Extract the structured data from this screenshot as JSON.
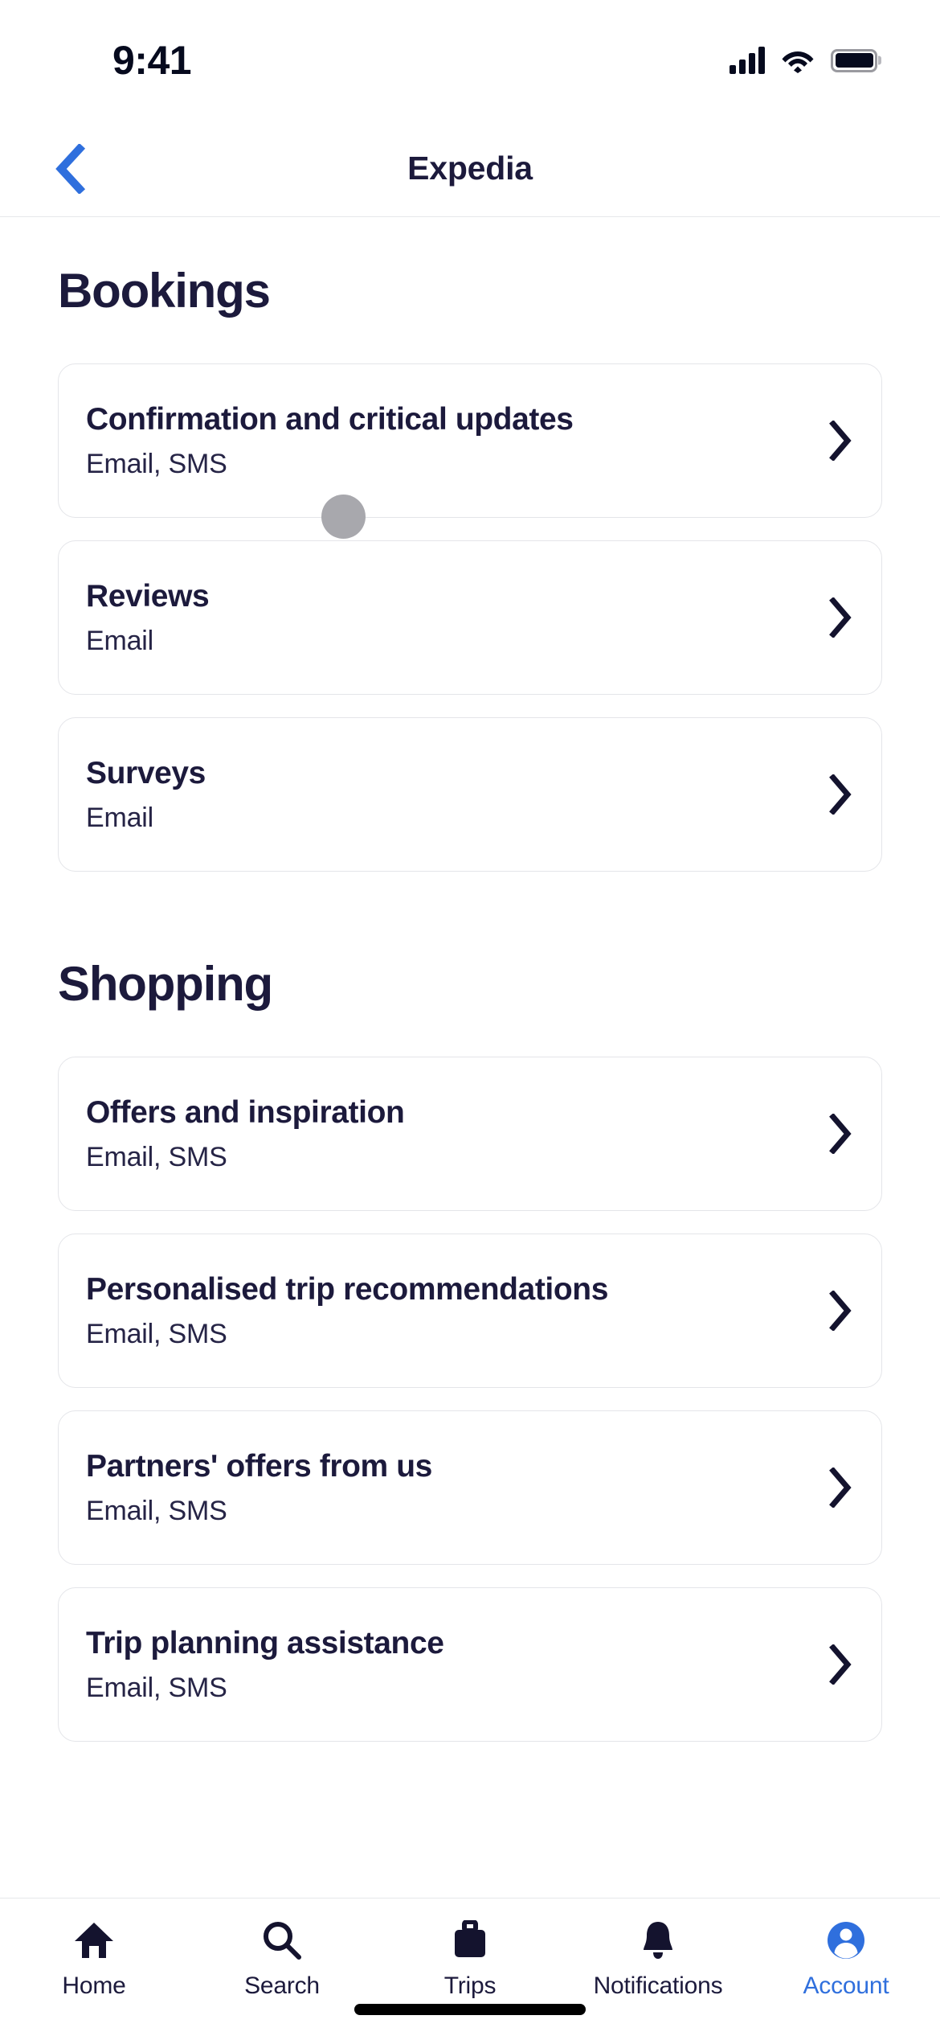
{
  "status_bar": {
    "time": "9:41",
    "cellular_icon": "cellular-signal-icon",
    "wifi_icon": "wifi-icon",
    "battery_icon": "battery-icon"
  },
  "header": {
    "back_icon": "chevron-left-icon",
    "title": "Expedia",
    "accent_color": "#2f6fdd"
  },
  "sections": [
    {
      "heading": "Bookings",
      "items": [
        {
          "title": "Confirmation and critical updates",
          "channels": "Email, SMS",
          "chevron": "chevron-right-icon"
        },
        {
          "title": "Reviews",
          "channels": "Email",
          "chevron": "chevron-right-icon"
        },
        {
          "title": "Surveys",
          "channels": "Email",
          "chevron": "chevron-right-icon"
        }
      ]
    },
    {
      "heading": "Shopping",
      "items": [
        {
          "title": "Offers and inspiration",
          "channels": "Email, SMS",
          "chevron": "chevron-right-icon"
        },
        {
          "title": "Personalised trip recommendations",
          "channels": "Email, SMS",
          "chevron": "chevron-right-icon"
        },
        {
          "title": "Partners' offers from us",
          "channels": "Email, SMS",
          "chevron": "chevron-right-icon"
        },
        {
          "title": "Trip planning assistance",
          "channels": "Email, SMS",
          "chevron": "chevron-right-icon"
        }
      ]
    }
  ],
  "tab_bar": {
    "active": "Account",
    "tabs": [
      {
        "label": "Home",
        "icon": "home-icon"
      },
      {
        "label": "Search",
        "icon": "search-icon"
      },
      {
        "label": "Trips",
        "icon": "briefcase-icon"
      },
      {
        "label": "Notifications",
        "icon": "bell-icon"
      },
      {
        "label": "Account",
        "icon": "account-person-icon"
      }
    ]
  },
  "cursor": {
    "type": "touch-cursor-dot",
    "color": "#a8a8ad"
  },
  "colors": {
    "text_primary": "#1c1a3c",
    "accent_blue": "#2f6fdd",
    "card_border": "#e4e5e9",
    "background": "#ffffff"
  }
}
